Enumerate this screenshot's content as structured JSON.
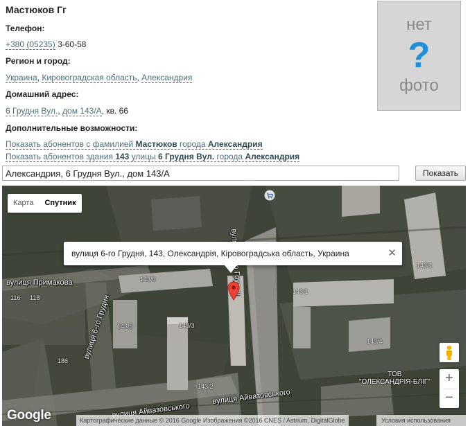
{
  "person": {
    "name": "Мастюков Гг"
  },
  "phone": {
    "label": "Телефон:",
    "code": "+380 (05235)",
    "number": "3-60-58"
  },
  "region": {
    "label": "Регион и город:",
    "country": "Украина",
    "oblast": "Кировоградская область",
    "city": "Александрия",
    "sep": ", "
  },
  "home": {
    "label": "Домашний адрес:",
    "street": "6 Грудня Вул.",
    "house": "дом 143/А",
    "apt": ", кв. 66",
    "sep": ", "
  },
  "extras": {
    "label": "Дополнительные возможности:",
    "link1": {
      "prefix": "Показать абонентов с фамилией ",
      "surname": "Мастюков",
      "mid": " города ",
      "city": "Александрия"
    },
    "link2": {
      "prefix": "Показать абонентов здания ",
      "house": "143",
      "mid1": " улицы ",
      "street": "6 Грудня Вул.",
      "mid2": " города ",
      "city": "Александрия"
    }
  },
  "photo": {
    "line1": "нет",
    "icon": "?",
    "line2": "фото"
  },
  "search": {
    "value": "Александрия, 6 Грудня Вул., дом 143/А",
    "button": "Показать"
  },
  "map": {
    "type_map": "Карта",
    "type_satellite": "Спутник",
    "info_text": "вулиця 6-го Грудня, 143, Олександрія, Кіровоградська область, Украина",
    "info_close": "✕",
    "streets": {
      "s1": "вулиця Примакова",
      "s2": "вулиця 6-го Грудня",
      "s3": "вулиця 6-го Грудня",
      "s4": "вулиця Айвазовського",
      "s5": "вулиця Айвазовського"
    },
    "poi": "ТОВ\n\"ОЛЕКСАНДРІЯ-БЛІГ\"",
    "house_numbers": {
      "n1": "143/1",
      "n2": "143/6",
      "n3": "143/5",
      "n4": "143/3",
      "n5": "143/4",
      "n6": "143/2",
      "n7": "143/1",
      "n8": "116",
      "n9": "118",
      "n10": "186"
    },
    "zoom_in": "+",
    "zoom_out": "−",
    "google": "Google",
    "attribution": "Картографические данные © 2016 Google Изображения ©2016 CNES / Astrium, DigitalGlobe",
    "terms": "Условия использования",
    "icons": {
      "marker": "map-marker-icon",
      "pegman": "pegman-icon",
      "cart": "shopping-cart-icon"
    },
    "colors": {
      "marker": "#ea4335",
      "pegman": "#f5b400",
      "link": "#4b6f7f",
      "photo_q": "#1e8fd8"
    }
  }
}
